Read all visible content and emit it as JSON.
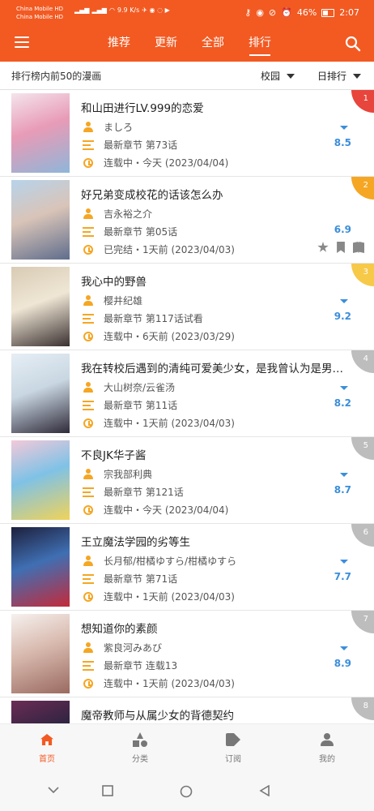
{
  "status": {
    "carrier1": "China Mobile HD",
    "carrier2": "China Mobile HD",
    "net_speed": "9.9 K/s",
    "battery": "46%",
    "time": "2:07"
  },
  "tabs": [
    {
      "label": "推荐"
    },
    {
      "label": "更新"
    },
    {
      "label": "全部"
    },
    {
      "label": "排行"
    }
  ],
  "filter": {
    "title": "排行榜内前50的漫画",
    "scope": "校园",
    "period": "日排行"
  },
  "colors": {
    "brand": "#f25a22",
    "rank1": "#e8453c",
    "rank2": "#f5a623",
    "rank3": "#f7c948",
    "rank_other": "#bdbdbd",
    "score": "#3b8edb",
    "icon": "#f5a623"
  },
  "items": [
    {
      "rank": "1",
      "title": "和山田进行LV.999的恋爱",
      "author": "ましろ",
      "chapter": "最新章节 第73话",
      "status": "连载中・今天 (2023/04/04)",
      "score": "8.5",
      "cover": [
        "#f4e4ec",
        "#8fb6d9",
        "#e89bb6"
      ]
    },
    {
      "rank": "2",
      "title": "好兄弟变成校花的话该怎么办",
      "author": "吉永裕之介",
      "chapter": "最新章节 第05话",
      "status": "已完结・1天前 (2023/04/03)",
      "score": "6.9",
      "cover": [
        "#b7d3ea",
        "#5f6d8c",
        "#d9c4b8"
      ]
    },
    {
      "rank": "3",
      "title": "我心中的野兽",
      "author": "樱井纪雄",
      "chapter": "最新章节 第117话试看",
      "status": "连载中・6天前 (2023/03/29)",
      "score": "9.2",
      "cover": [
        "#d8cbb4",
        "#3a3030",
        "#efe6d5"
      ]
    },
    {
      "rank": "4",
      "title": "我在转校后遇到的清纯可爱美少女，是我曾认为是男孩子的青梅竹马",
      "author": "大山树奈/云雀汤",
      "chapter": "最新章节 第11话",
      "status": "连载中・1天前 (2023/04/03)",
      "score": "8.2",
      "cover": [
        "#e6eef5",
        "#2f2a3a",
        "#c9d7e2"
      ]
    },
    {
      "rank": "5",
      "title": "不良JK华子酱",
      "author": "宗我部利典",
      "chapter": "最新章节 第121话",
      "status": "连载中・今天 (2023/04/04)",
      "score": "8.7",
      "cover": [
        "#f3c9d9",
        "#f0d35a",
        "#7fc2e6"
      ]
    },
    {
      "rank": "6",
      "title": "王立魔法学园的劣等生",
      "author": "长月郁/柑橘ゆすら/柑橘ゆすら",
      "chapter": "最新章节 第71话",
      "status": "连载中・1天前 (2023/04/03)",
      "score": "7.7",
      "cover": [
        "#1d1f3b",
        "#c42a3a",
        "#3f6fb3"
      ]
    },
    {
      "rank": "7",
      "title": "想知道你的素颜",
      "author": "紫良河みあび",
      "chapter": "最新章节 连载13",
      "status": "连载中・1天前 (2023/04/03)",
      "score": "8.9",
      "cover": [
        "#f6f1ee",
        "#9a6a60",
        "#d8b9ae"
      ]
    },
    {
      "rank": "8",
      "title": "魔帝教师与从属少女的背德契约",
      "author": "",
      "chapter": "",
      "status": "",
      "score": "",
      "cover": [
        "#6b2c55",
        "#f3b6c9",
        "#2c2340"
      ]
    }
  ],
  "row2_actions": [
    "star-icon",
    "bookmark-icon",
    "book-icon"
  ],
  "bottom_nav": [
    {
      "label": "首页",
      "icon": "home-icon"
    },
    {
      "label": "分类",
      "icon": "category-icon"
    },
    {
      "label": "订阅",
      "icon": "tag-icon"
    },
    {
      "label": "我的",
      "icon": "profile-icon"
    }
  ]
}
